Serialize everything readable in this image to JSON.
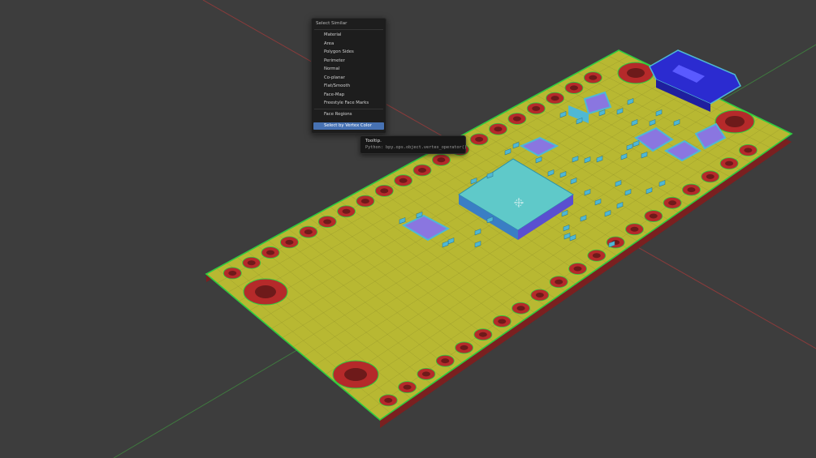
{
  "menu": {
    "title": "Select Similar",
    "items": [
      {
        "label": "Material"
      },
      {
        "label": "Area"
      },
      {
        "label": "Polygon Sides"
      },
      {
        "label": "Perimeter"
      },
      {
        "label": "Normal"
      },
      {
        "label": "Co-planar"
      },
      {
        "label": "Flat/Smooth"
      },
      {
        "label": "Face-Map"
      },
      {
        "label": "Freestyle Face Marks"
      }
    ],
    "extra_items": [
      {
        "label": "Face Regions"
      },
      {
        "label": "Select by Vertex Color",
        "active": true
      }
    ]
  },
  "tooltip": {
    "title": "Tooltip.",
    "python": "Python: bpy.ops.object.vertex_operator()"
  },
  "viewport": {
    "background": "#3d3d3d",
    "board_color": "#b8b832",
    "pad_color": "#b52a2a",
    "outline_color": "#2ecc40",
    "component_color": "#4fb8d4",
    "chip_color": "#8a76e0"
  }
}
